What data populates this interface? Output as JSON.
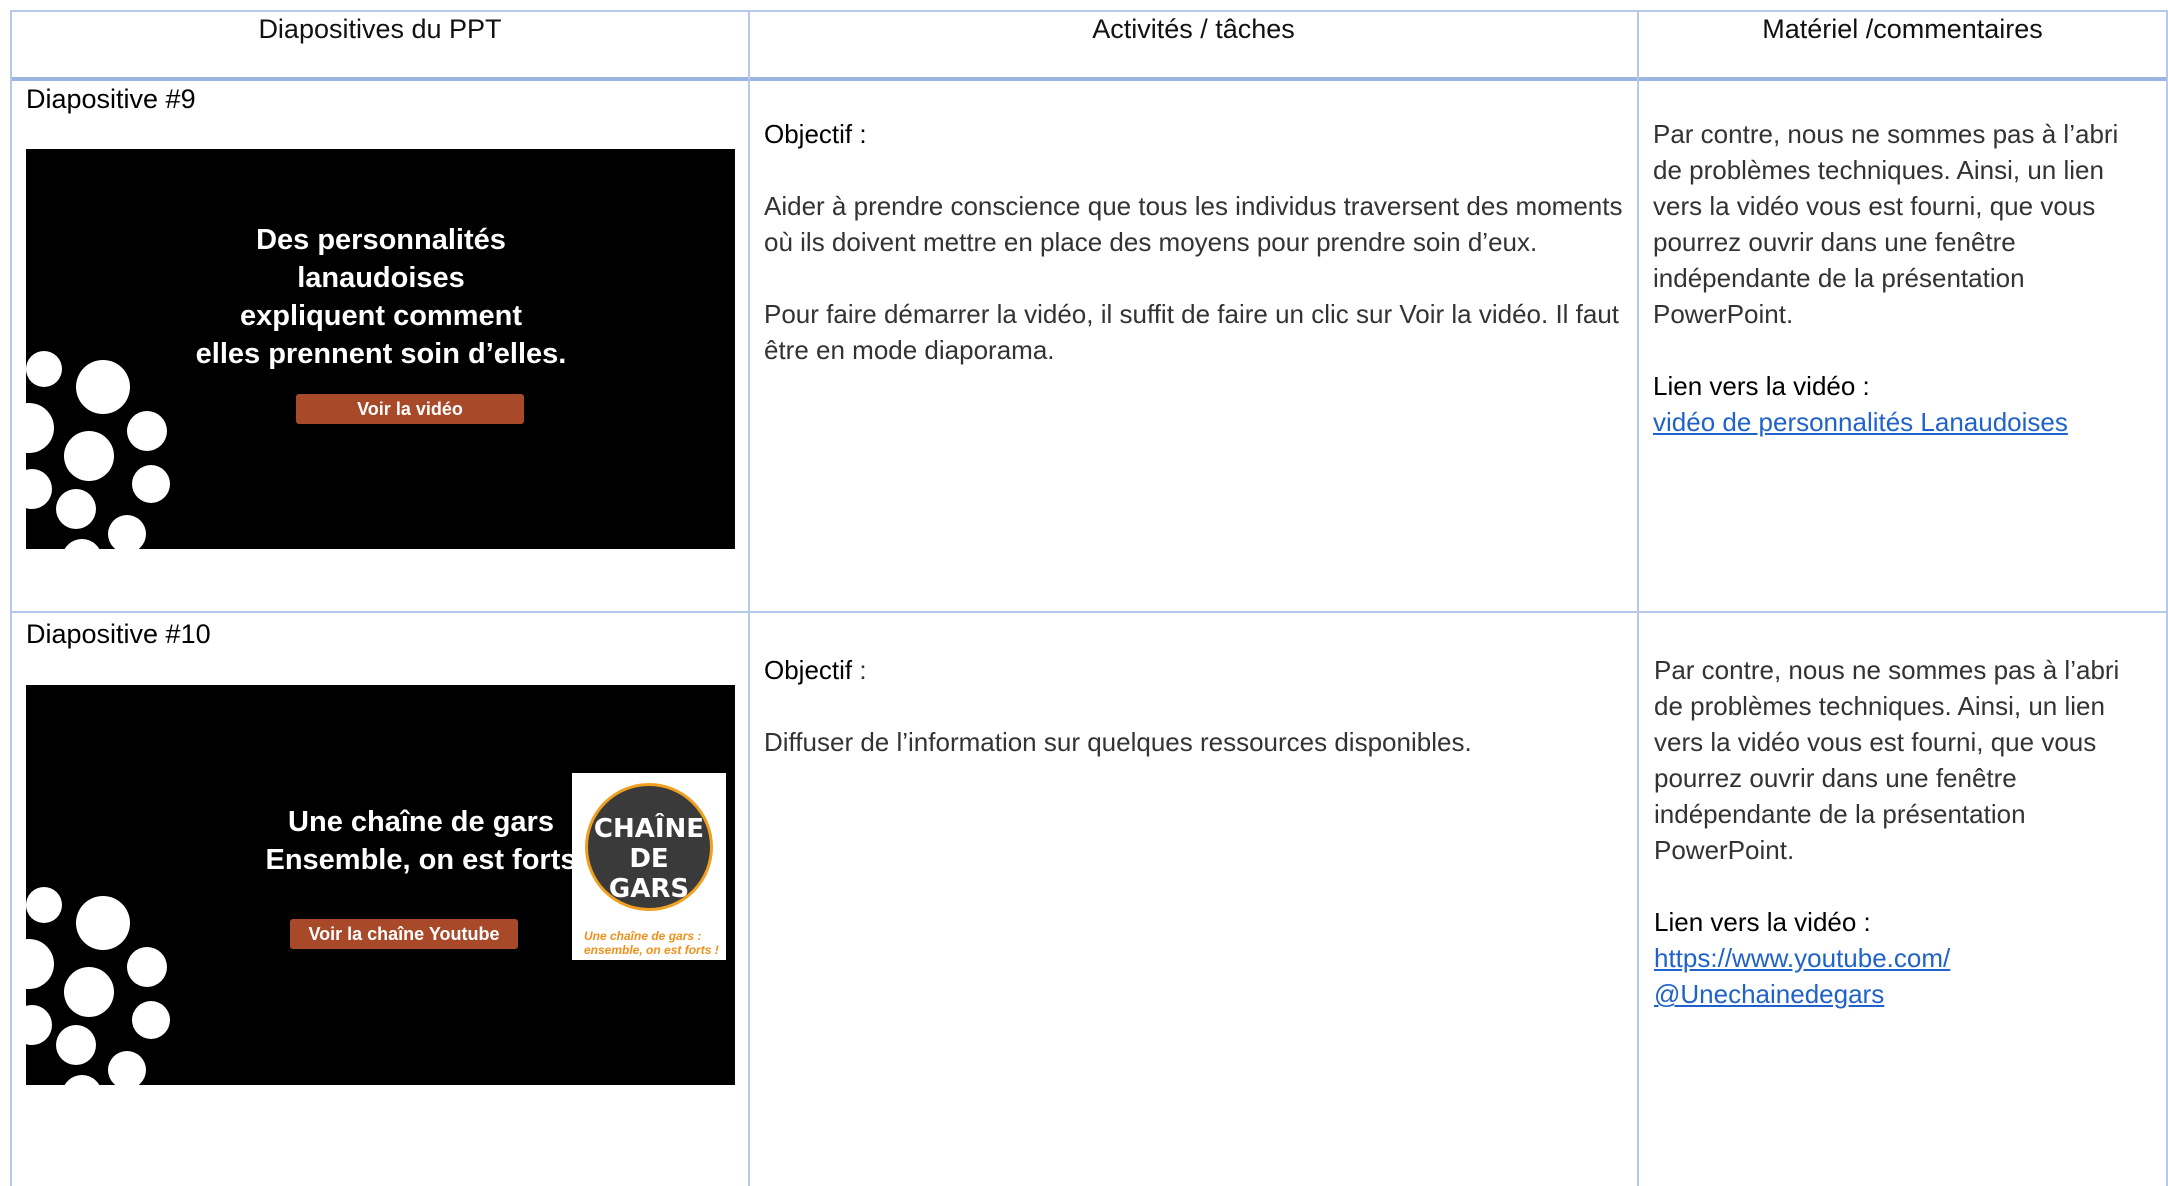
{
  "columns": {
    "slides": "Diapositives du PPT",
    "activities": "Activités / tâches",
    "material": "Matériel /commentaires"
  },
  "rows": [
    {
      "slide_label": "Diapositive #9",
      "slide": {
        "title": "Des personnalités lanaudoises\nexpliquent comment\nelles prennent soin d’elles.",
        "button": "Voir la vidéo"
      },
      "activity": {
        "heading": "Objectif :",
        "paragraphs": [
          "Aider à prendre conscience que tous les individus traversent des moments où ils doivent mettre en place des moyens pour prendre soin d’eux.",
          "Pour faire démarrer la vidéo, il suffit de faire un clic sur Voir la vidéo. Il faut être en mode diaporama."
        ]
      },
      "material": {
        "text": "Par contre, nous ne sommes pas à l’abri de problèmes techniques. Ainsi, un lien vers la vidéo vous est fourni, que vous pourrez ouvrir dans une fenêtre indépendante de la présentation PowerPoint.",
        "link_heading": "Lien vers la vidéo :",
        "link": "vidéo de personnalités Lanaudoises"
      }
    },
    {
      "slide_label": "Diapositive #10",
      "slide": {
        "title": "Une chaîne de gars\nEnsemble, on est forts",
        "button": "Voir la chaîne Youtube",
        "logo": {
          "line1": "CHAÎNE",
          "line2": "DE GARS",
          "caption": "Une chaîne de gars :\nensemble, on est forts !"
        }
      },
      "activity": {
        "heading": "Objectif",
        "heading_suffix": " :",
        "paragraphs": [
          "Diffuser de l’information sur quelques ressources disponibles."
        ]
      },
      "material": {
        "text": "Par contre, nous ne sommes pas à l’abri de problèmes techniques. Ainsi, un lien vers la vidéo vous est fourni, que vous pourrez ouvrir dans une fenêtre indépendante de la présentation PowerPoint.",
        "link_heading": "Lien vers la vidéo :",
        "link": "https://www.youtube.com/\n@Unechainedegars"
      }
    }
  ],
  "colors": {
    "grid": "#b6c9e8",
    "link": "#1f62c9",
    "slide_button": "#a84a2a",
    "logo_accent": "#f0a020"
  }
}
